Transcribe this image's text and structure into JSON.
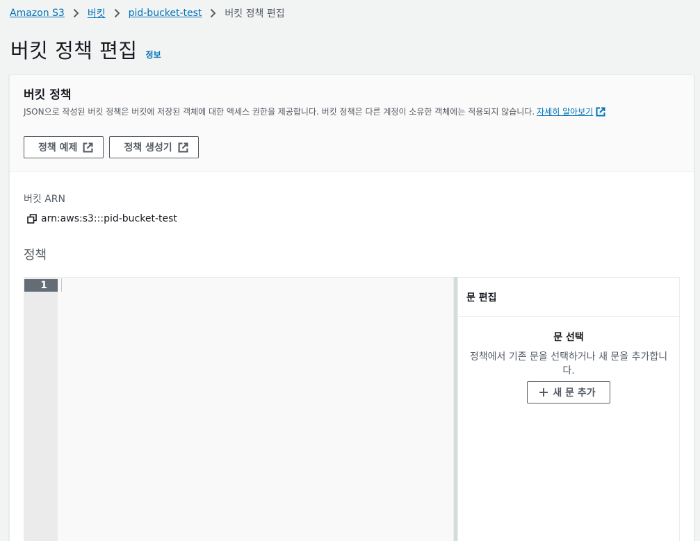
{
  "breadcrumb": {
    "items": [
      "Amazon S3",
      "버킷",
      "pid-bucket-test"
    ],
    "current": "버킷 정책 편집"
  },
  "page": {
    "title": "버킷 정책 편집",
    "info_link": "정보"
  },
  "policy_container": {
    "heading": "버킷 정책",
    "description": "JSON으로 작성된 버킷 정책은 버킷에 저장된 객체에 대한 액세스 권한을 제공합니다. 버킷 정책은 다른 계정이 소유한 객체에는 적용되지 않습니다.",
    "learn_more": "자세히 알아보기",
    "buttons": {
      "policy_examples": "정책 예제",
      "policy_generator": "정책 생성기"
    }
  },
  "bucket_arn": {
    "label": "버킷 ARN",
    "value": "arn:aws:s3:::pid-bucket-test"
  },
  "policy_editor": {
    "label": "정책",
    "line_number": "1"
  },
  "statement_panel": {
    "title": "문 편집",
    "empty_title": "문 선택",
    "empty_description": "정책에서 기존 문을 선택하거나 새 문을 추가합니다.",
    "add_button": "새 문 추가"
  },
  "colors": {
    "link": "#0073bb",
    "text": "#16191f",
    "secondary_text": "#545b64",
    "page_background": "#f2f3f3",
    "gutter_active": "#646d75"
  }
}
